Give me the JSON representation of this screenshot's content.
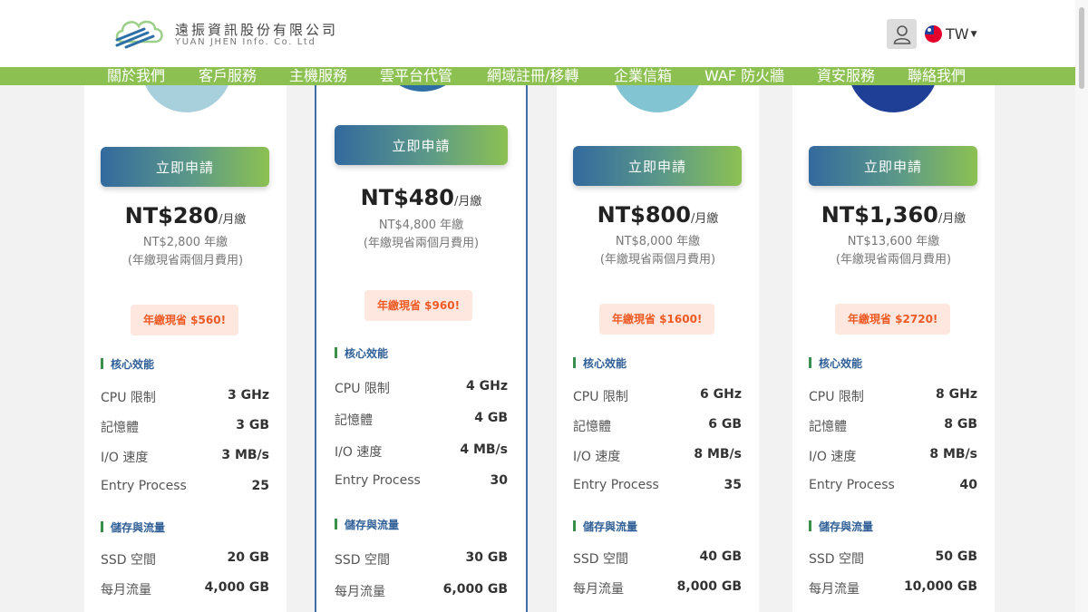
{
  "brand": {
    "name_cn": "遠振資訊股份有限公司",
    "name_en": "YUAN JHEN Info. Co. Ltd"
  },
  "header": {
    "user_icon": "user-icon",
    "language": "TW",
    "language_flag": "taiwan-flag-icon"
  },
  "nav": [
    "關於我們",
    "客戶服務",
    "主機服務",
    "雲平台代管",
    "網域註冊/移轉",
    "企業信箱",
    "WAF 防火牆",
    "資安服務",
    "聯絡我們"
  ],
  "colors": {
    "nav_green": "#8cc152",
    "button_start": "#336a9e",
    "button_end": "#8cc152",
    "save_text": "#ee5a24",
    "save_bg": "#fde7df",
    "section_blue": "#2f5f96"
  },
  "section_labels": {
    "core": "核心效能",
    "storage": "儲存與流量"
  },
  "plans": [
    {
      "button": "立即申請",
      "price": "NT$280",
      "unit": "/月繳",
      "annual": "NT$2,800 年繳",
      "annual_note": "(年繳現省兩個月費用)",
      "save": "年繳現省 $560!",
      "specs": [
        {
          "label": "CPU 限制",
          "value": "3 GHz"
        },
        {
          "label": "記憶體",
          "value": "3 GB"
        },
        {
          "label": "I/O 速度",
          "value": "3 MB/s"
        },
        {
          "label": "Entry Process",
          "value": "25"
        }
      ],
      "storage": [
        {
          "label": "SSD 空間",
          "value": "20 GB"
        },
        {
          "label": "每月流量",
          "value": "4,000 GB"
        }
      ]
    },
    {
      "button": "立即申請",
      "price": "NT$480",
      "unit": "/月繳",
      "annual": "NT$4,800 年繳",
      "annual_note": "(年繳現省兩個月費用)",
      "save": "年繳現省 $960!",
      "specs": [
        {
          "label": "CPU 限制",
          "value": "4 GHz"
        },
        {
          "label": "記憶體",
          "value": "4 GB"
        },
        {
          "label": "I/O 速度",
          "value": "4 MB/s"
        },
        {
          "label": "Entry Process",
          "value": "30"
        }
      ],
      "storage": [
        {
          "label": "SSD 空間",
          "value": "30 GB"
        },
        {
          "label": "每月流量",
          "value": "6,000 GB"
        }
      ]
    },
    {
      "button": "立即申請",
      "price": "NT$800",
      "unit": "/月繳",
      "annual": "NT$8,000 年繳",
      "annual_note": "(年繳現省兩個月費用)",
      "save": "年繳現省 $1600!",
      "specs": [
        {
          "label": "CPU 限制",
          "value": "6 GHz"
        },
        {
          "label": "記憶體",
          "value": "6 GB"
        },
        {
          "label": "I/O 速度",
          "value": "8 MB/s"
        },
        {
          "label": "Entry Process",
          "value": "35"
        }
      ],
      "storage": [
        {
          "label": "SSD 空間",
          "value": "40 GB"
        },
        {
          "label": "每月流量",
          "value": "8,000 GB"
        }
      ]
    },
    {
      "button": "立即申請",
      "price": "NT$1,360",
      "unit": "/月繳",
      "annual": "NT$13,600 年繳",
      "annual_note": "(年繳現省兩個月費用)",
      "save": "年繳現省 $2720!",
      "specs": [
        {
          "label": "CPU 限制",
          "value": "8 GHz"
        },
        {
          "label": "記憶體",
          "value": "8 GB"
        },
        {
          "label": "I/O 速度",
          "value": "8 MB/s"
        },
        {
          "label": "Entry Process",
          "value": "40"
        }
      ],
      "storage": [
        {
          "label": "SSD 空間",
          "value": "50 GB"
        },
        {
          "label": "每月流量",
          "value": "10,000 GB"
        }
      ]
    }
  ]
}
